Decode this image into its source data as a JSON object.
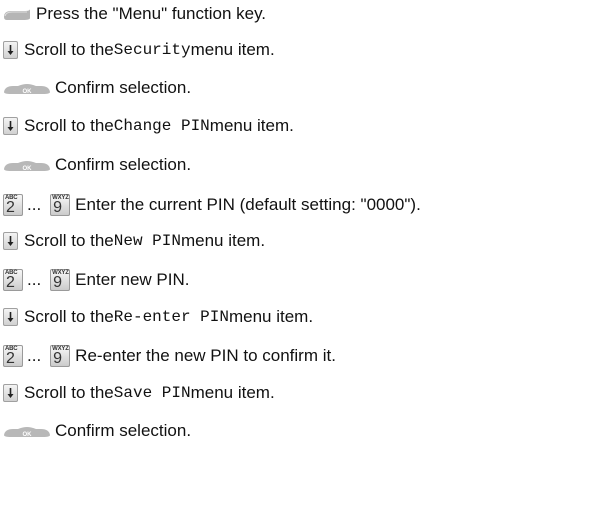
{
  "steps": [
    {
      "key": "function-key",
      "text": "Press the \"Menu\" function key."
    },
    {
      "key": "scroll-down",
      "pre": "Scroll to the ",
      "mono": "Security",
      "post": " menu item."
    },
    {
      "key": "ok-key",
      "ok_label": "OK",
      "text": "Confirm selection."
    },
    {
      "key": "scroll-down",
      "pre": "Scroll to the ",
      "mono": "Change PIN",
      "post": " menu item."
    },
    {
      "key": "ok-key",
      "ok_label": "OK",
      "text": "Confirm selection."
    },
    {
      "key": "num-range",
      "from": {
        "letters": "ABC",
        "digit": "2"
      },
      "ellipsis": "...",
      "to": {
        "letters": "WXYZ",
        "digit": "9"
      },
      "text": "Enter the current PIN (default setting: \"0000\")."
    },
    {
      "key": "scroll-down",
      "pre": "Scroll to the ",
      "mono": "New PIN",
      "post": " menu item."
    },
    {
      "key": "num-range",
      "from": {
        "letters": "ABC",
        "digit": "2"
      },
      "ellipsis": "...",
      "to": {
        "letters": "WXYZ",
        "digit": "9"
      },
      "text": "Enter new PIN."
    },
    {
      "key": "scroll-down",
      "pre": "Scroll to the ",
      "mono": "Re-enter PIN",
      "post": " menu item."
    },
    {
      "key": "num-range",
      "from": {
        "letters": "ABC",
        "digit": "2"
      },
      "ellipsis": "...",
      "to": {
        "letters": "WXYZ",
        "digit": "9"
      },
      "text": "Re-enter the new PIN to confirm it."
    },
    {
      "key": "scroll-down",
      "pre": "Scroll to the ",
      "mono": "Save PIN",
      "post": " menu item."
    },
    {
      "key": "ok-key",
      "ok_label": "OK",
      "text": "Confirm selection."
    }
  ],
  "colors": {
    "text": "#111111",
    "key_grey": "#b8b8b8"
  }
}
